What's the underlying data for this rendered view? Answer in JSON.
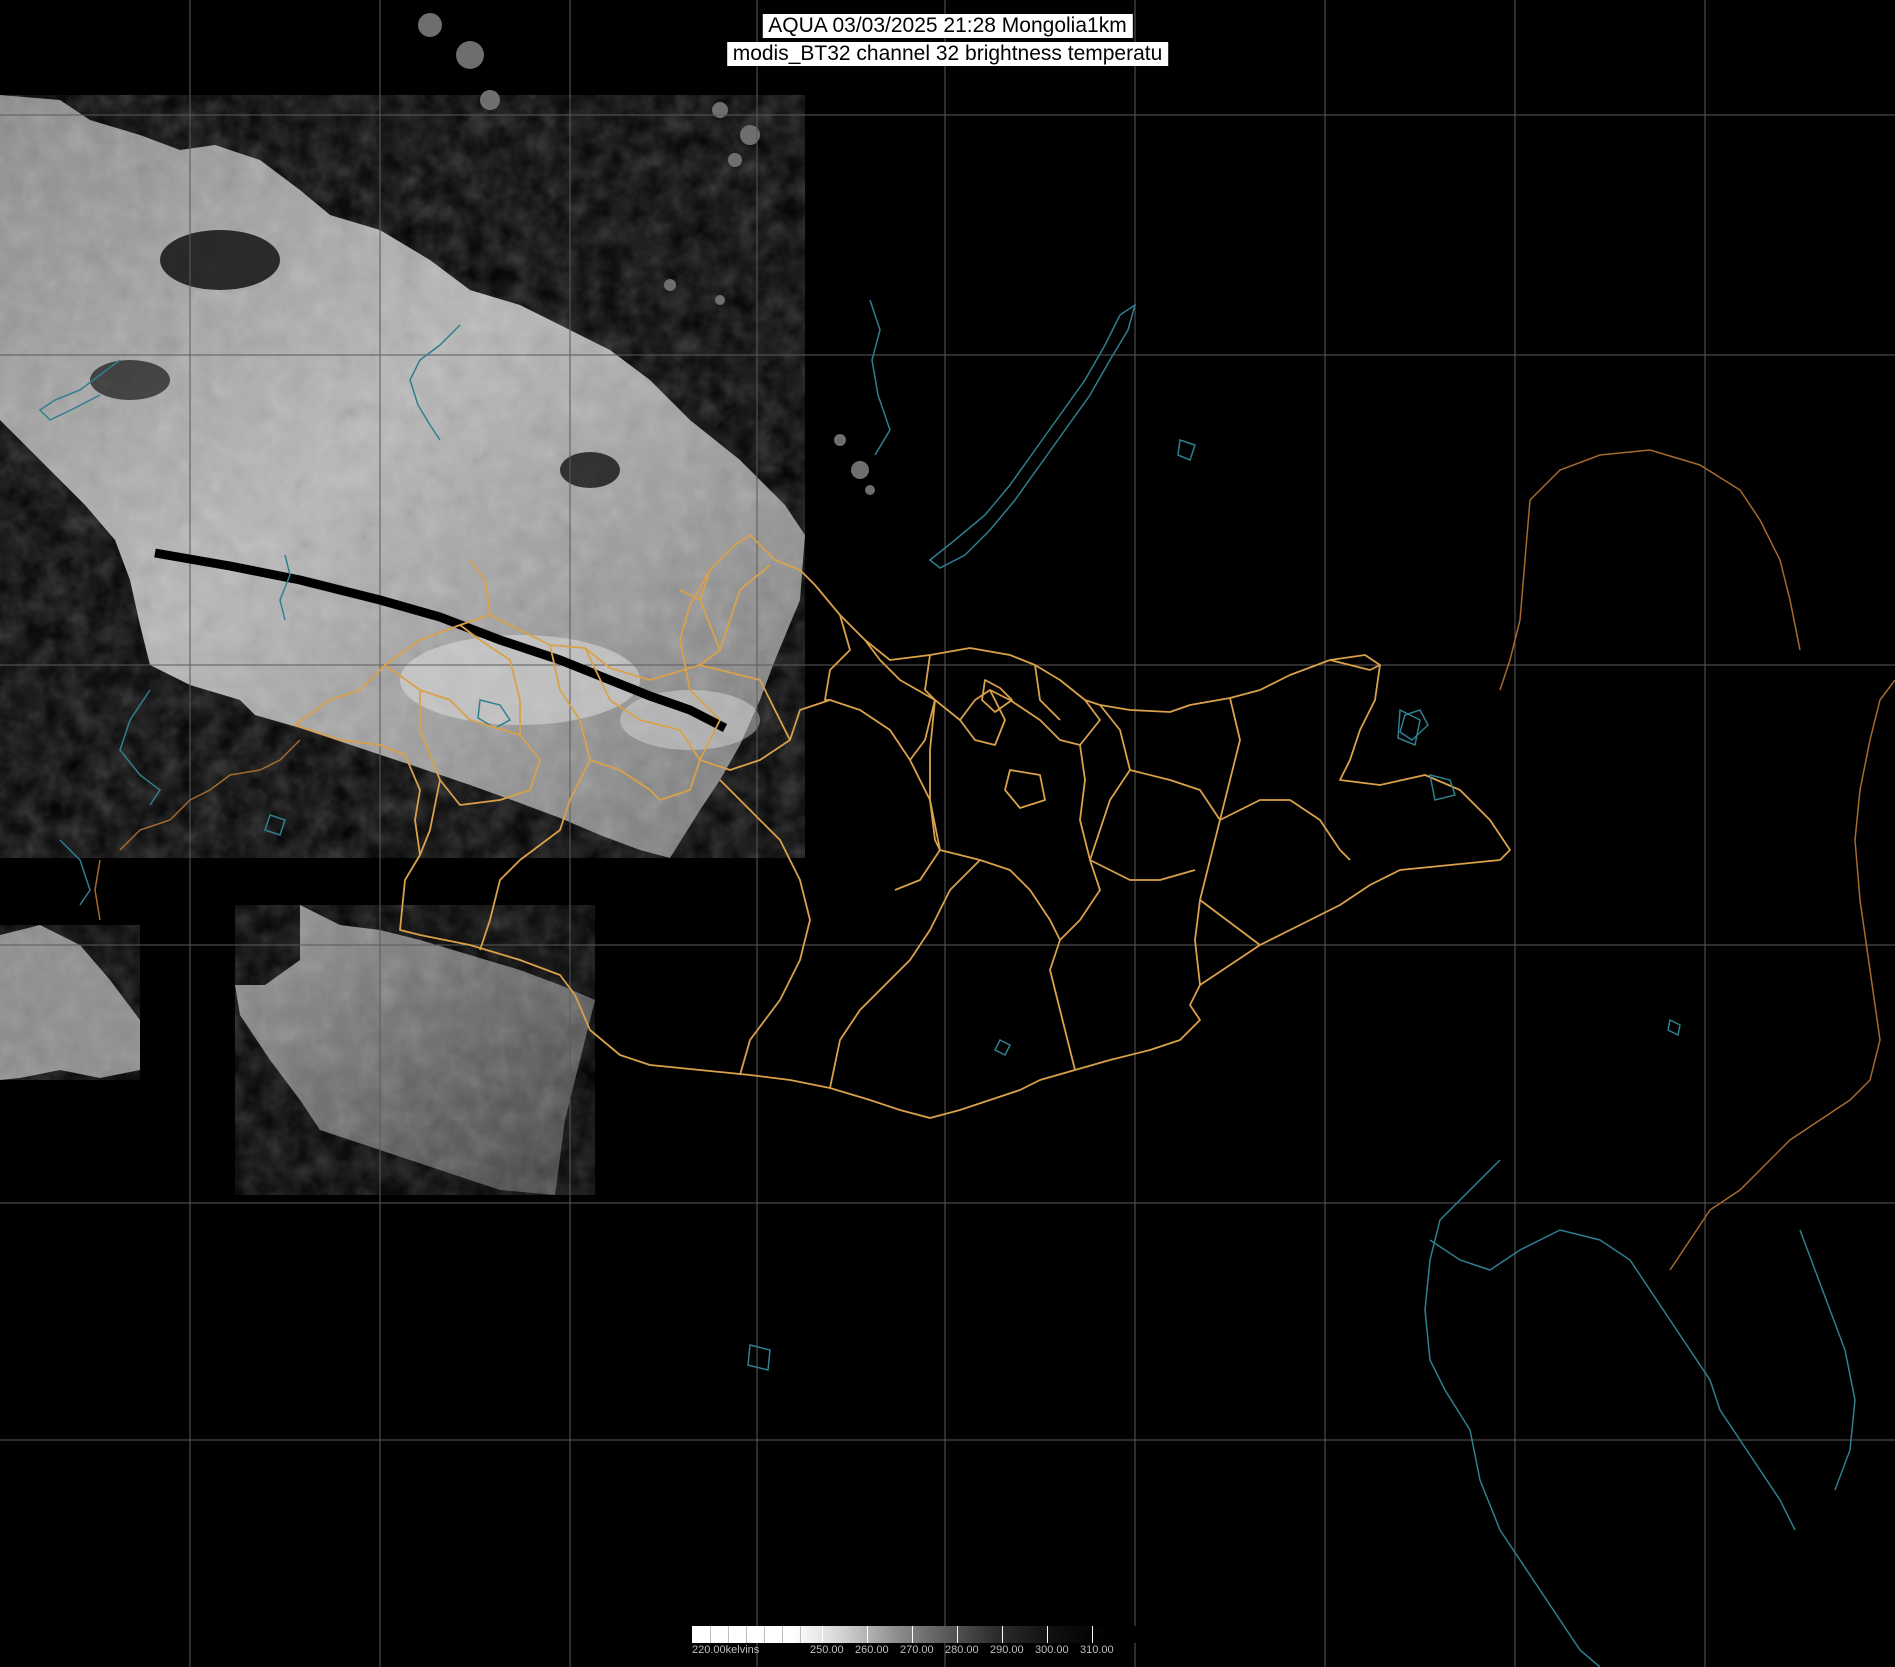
{
  "title": {
    "line1": "AQUA 03/03/2025 21:28 Mongolia1km",
    "line2": "modis_BT32 channel 32 brightness temperatu"
  },
  "colorbar": {
    "unit_label": "220.00kelvins",
    "ticks": [
      "250.00",
      "260.00",
      "270.00",
      "280.00",
      "290.00",
      "300.00",
      "310.00"
    ]
  },
  "colors": {
    "background": "#000000",
    "graticule": "#5a5a5a",
    "province_borders": "#d9a14a",
    "coastlines_lakes": "#2f7f8f",
    "country_border_east": "#a56a2e"
  },
  "layers": [
    "graticule",
    "satellite-swath",
    "orbit-track",
    "province-borders",
    "coastlines",
    "colorbar"
  ]
}
